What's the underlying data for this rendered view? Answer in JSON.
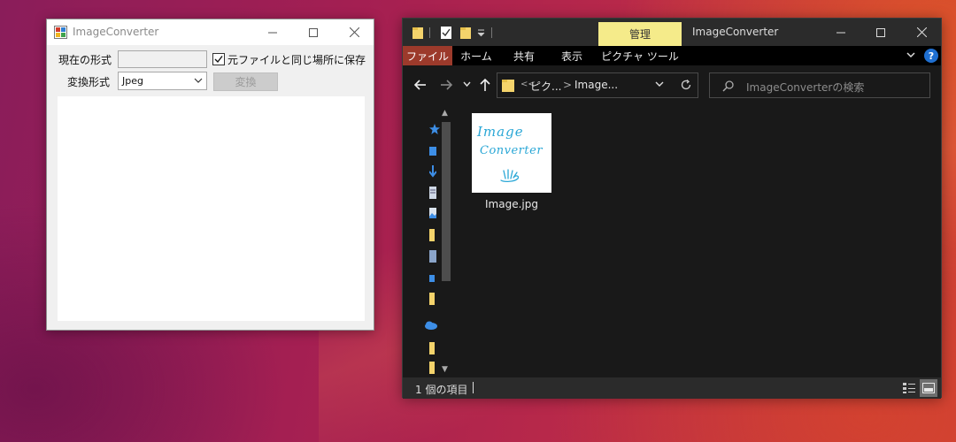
{
  "image_converter": {
    "title": "ImageConverter",
    "current_format_label": "現在の形式",
    "current_format_value": "",
    "save_same_location_label": "元ファイルと同じ場所に保存",
    "save_same_location_checked": true,
    "convert_format_label": "変換形式",
    "convert_format_value": "Jpeg",
    "convert_button_label": "変換"
  },
  "explorer": {
    "ribbon_context_tab": "管理",
    "window_title": "ImageConverter",
    "ribbon_tabs": {
      "file": "ファイル",
      "home": "ホーム",
      "share": "共有",
      "view": "表示",
      "picture_tools": "ピクチャ ツール"
    },
    "address": {
      "overflow": "<<",
      "segment1": "ピク...",
      "separator": ">",
      "segment2": "Image..."
    },
    "search_placeholder": "ImageConverterの検索",
    "files": [
      {
        "name": "Image.jpg",
        "thumbnail_line1": "Image",
        "thumbnail_line2": "Converter"
      }
    ],
    "status_text": "1 個の項目"
  },
  "colors": {
    "picture_tools_highlight": "#f5eb8a",
    "file_tab": "#9c3a2b",
    "explorer_bg": "#191919",
    "thumbnail_ink": "#2aa7d6"
  }
}
